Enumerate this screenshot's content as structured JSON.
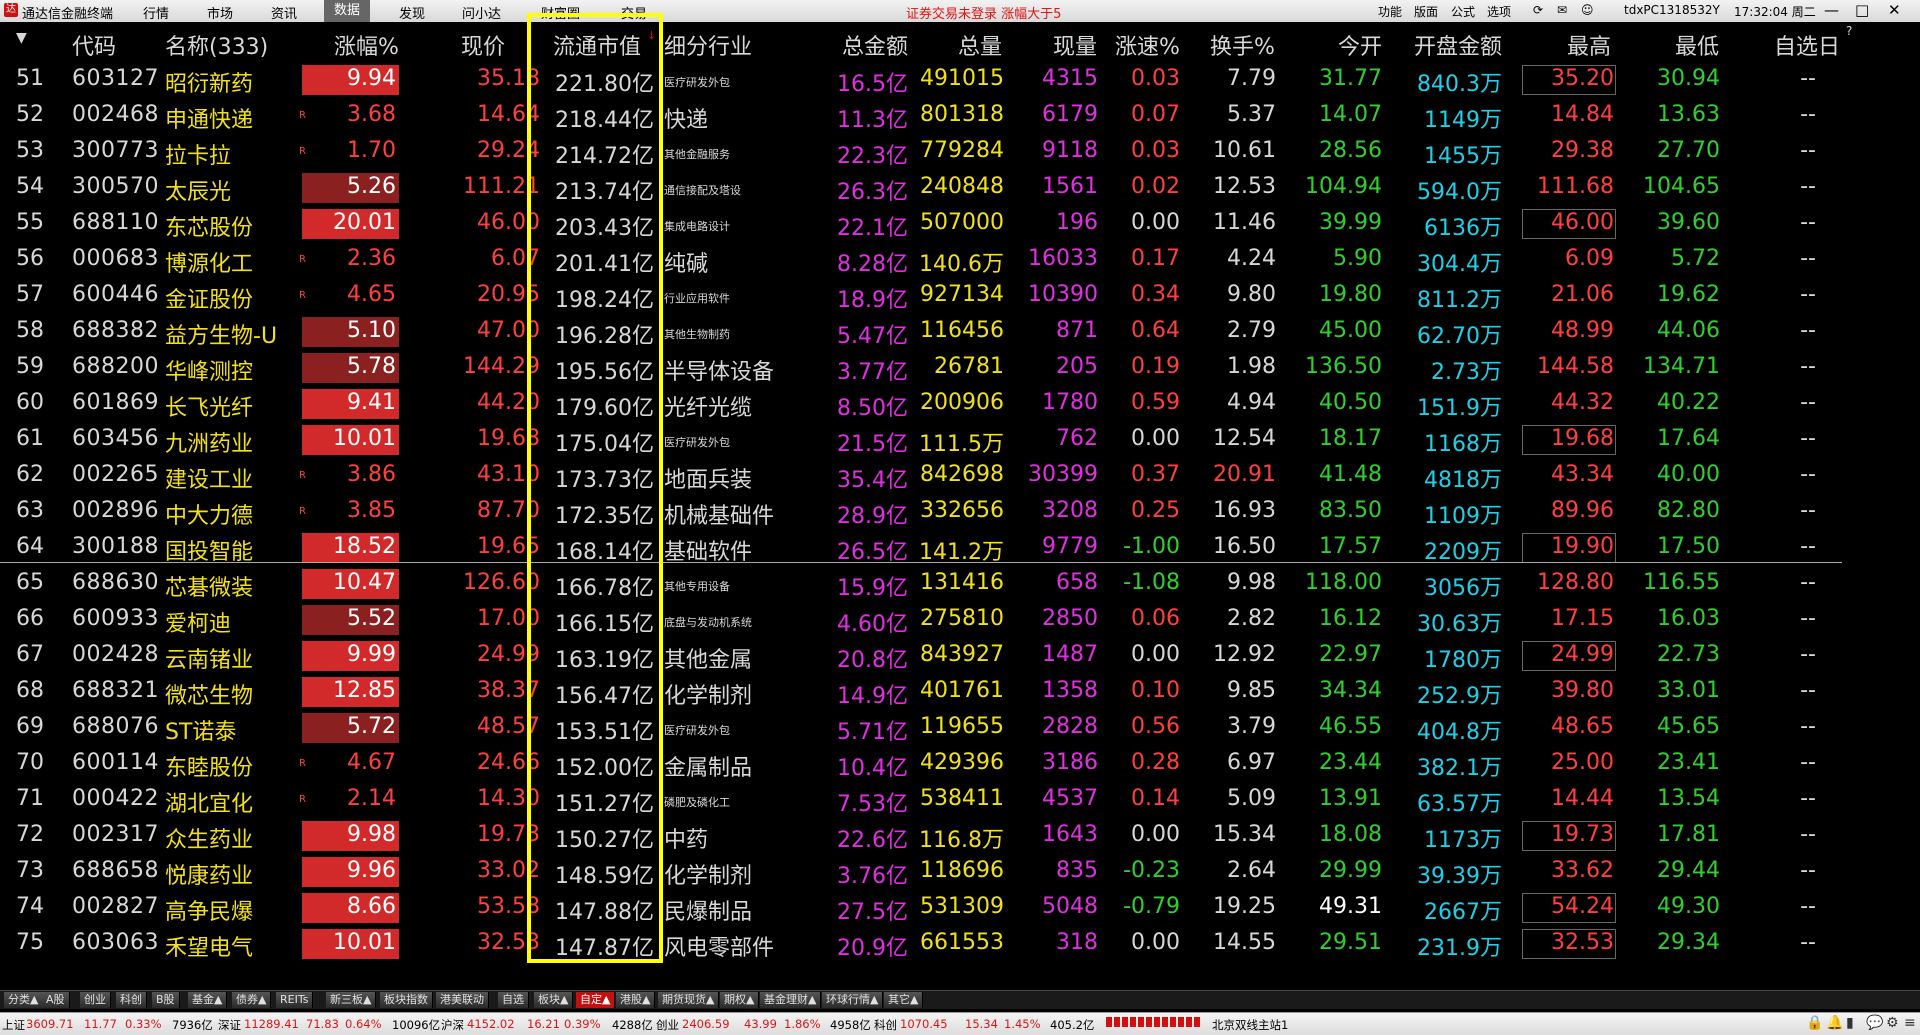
{
  "topbar": {
    "app_title": "通达信金融终端",
    "menus": [
      "行情",
      "市场",
      "资讯",
      "数据",
      "发现",
      "问小达",
      "财富圈",
      "交易"
    ],
    "active_menu": "数据",
    "notice": "证券交易未登录  涨幅大于5",
    "right_items": [
      "功能",
      "版面",
      "公式",
      "选项"
    ],
    "account": "tdxPC1318532Y",
    "time": "17:32:04 周二",
    "win_buttons": [
      "—",
      "□",
      "✕"
    ]
  },
  "header": {
    "code": "代码",
    "name": "名称(333)",
    "change_pct": "涨幅%",
    "price": "现价",
    "mkt_cap": "流通市值",
    "industry": "细分行业",
    "amount": "总金额",
    "volume": "总量",
    "cur_vol": "现量",
    "speed": "涨速%",
    "turnover": "换手%",
    "open": "今开",
    "open_amount": "开盘金额",
    "high": "最高",
    "low": "最低",
    "favorite": "自选日",
    "sort_mark": "↓",
    "help_mark": "?"
  },
  "rows": [
    {
      "idx": "51",
      "code": "603127",
      "name": "昭衍新药",
      "r": "",
      "chg": "9.94",
      "chg_bg": "#d22a2a",
      "price": "35.18",
      "mcap": "221.80亿",
      "ind": "医疗研发外包",
      "ind_small": true,
      "amt": "16.5亿",
      "vol": "491015",
      "cur": "4315",
      "spd": "0.03",
      "spd_t": "p",
      "turn": "7.79",
      "turn_r": false,
      "open": "31.77",
      "open_w": false,
      "oamt": "840.3万",
      "high": "35.20",
      "high_box": true,
      "low": "30.94",
      "fav": "--"
    },
    {
      "idx": "52",
      "code": "002468",
      "name": "申通快递",
      "r": "R",
      "chg": "3.68",
      "chg_bg": "",
      "price": "14.64",
      "mcap": "218.44亿",
      "ind": "快递",
      "ind_small": false,
      "amt": "11.3亿",
      "vol": "801318",
      "cur": "6179",
      "spd": "0.07",
      "spd_t": "p",
      "turn": "5.37",
      "turn_r": false,
      "open": "14.07",
      "open_w": false,
      "oamt": "1149万",
      "high": "14.84",
      "high_box": false,
      "low": "13.63",
      "fav": "--"
    },
    {
      "idx": "53",
      "code": "300773",
      "name": "拉卡拉",
      "r": "R",
      "chg": "1.70",
      "chg_bg": "",
      "price": "29.24",
      "mcap": "214.72亿",
      "ind": "其他金融服务",
      "ind_small": true,
      "amt": "22.3亿",
      "vol": "779284",
      "cur": "9118",
      "spd": "0.03",
      "spd_t": "p",
      "turn": "10.61",
      "turn_r": false,
      "open": "28.56",
      "open_w": false,
      "oamt": "1455万",
      "high": "29.38",
      "high_box": false,
      "low": "27.70",
      "fav": "--"
    },
    {
      "idx": "54",
      "code": "300570",
      "name": "太辰光",
      "r": "",
      "chg": "5.26",
      "chg_bg": "#8a2020",
      "price": "111.21",
      "mcap": "213.74亿",
      "ind": "通信接配及塔设",
      "ind_small": true,
      "amt": "26.3亿",
      "vol": "240848",
      "cur": "1561",
      "spd": "0.02",
      "spd_t": "p",
      "turn": "12.53",
      "turn_r": false,
      "open": "104.94",
      "open_w": false,
      "oamt": "594.0万",
      "high": "111.68",
      "high_box": false,
      "low": "104.65",
      "fav": "--"
    },
    {
      "idx": "55",
      "code": "688110",
      "name": "东芯股份",
      "r": "",
      "chg": "20.01",
      "chg_bg": "#d22a2a",
      "price": "46.00",
      "mcap": "203.43亿",
      "ind": "集成电路设计",
      "ind_small": true,
      "amt": "22.1亿",
      "vol": "507000",
      "cur": "196",
      "spd": "0.00",
      "spd_t": "z",
      "turn": "11.46",
      "turn_r": false,
      "open": "39.99",
      "open_w": false,
      "oamt": "6136万",
      "high": "46.00",
      "high_box": true,
      "low": "39.60",
      "fav": "--"
    },
    {
      "idx": "56",
      "code": "000683",
      "name": "博源化工",
      "r": "R",
      "chg": "2.36",
      "chg_bg": "",
      "price": "6.07",
      "mcap": "201.41亿",
      "ind": "纯碱",
      "ind_small": false,
      "amt": "8.28亿",
      "vol": "140.6万",
      "cur": "16033",
      "spd": "0.17",
      "spd_t": "p",
      "turn": "4.24",
      "turn_r": false,
      "open": "5.90",
      "open_w": false,
      "oamt": "304.4万",
      "high": "6.09",
      "high_box": false,
      "low": "5.72",
      "fav": "--"
    },
    {
      "idx": "57",
      "code": "600446",
      "name": "金证股份",
      "r": "R",
      "chg": "4.65",
      "chg_bg": "",
      "price": "20.95",
      "mcap": "198.24亿",
      "ind": "行业应用软件",
      "ind_small": true,
      "amt": "18.9亿",
      "vol": "927134",
      "cur": "10390",
      "spd": "0.34",
      "spd_t": "p",
      "turn": "9.80",
      "turn_r": false,
      "open": "19.80",
      "open_w": false,
      "oamt": "811.2万",
      "high": "21.06",
      "high_box": false,
      "low": "19.62",
      "fav": "--"
    },
    {
      "idx": "58",
      "code": "688382",
      "name": "益方生物-U",
      "r": "",
      "chg": "5.10",
      "chg_bg": "#8a2020",
      "price": "47.00",
      "mcap": "196.28亿",
      "ind": "其他生物制药",
      "ind_small": true,
      "amt": "5.47亿",
      "vol": "116456",
      "cur": "871",
      "spd": "0.64",
      "spd_t": "p",
      "turn": "2.79",
      "turn_r": false,
      "open": "45.00",
      "open_w": false,
      "oamt": "62.70万",
      "high": "48.99",
      "high_box": false,
      "low": "44.06",
      "fav": "--"
    },
    {
      "idx": "59",
      "code": "688200",
      "name": "华峰测控",
      "r": "",
      "chg": "5.78",
      "chg_bg": "#8a2020",
      "price": "144.29",
      "mcap": "195.56亿",
      "ind": "半导体设备",
      "ind_small": false,
      "amt": "3.77亿",
      "vol": "26781",
      "cur": "205",
      "spd": "0.19",
      "spd_t": "p",
      "turn": "1.98",
      "turn_r": false,
      "open": "136.50",
      "open_w": false,
      "oamt": "2.73万",
      "high": "144.58",
      "high_box": false,
      "low": "134.71",
      "fav": "--"
    },
    {
      "idx": "60",
      "code": "601869",
      "name": "长飞光纤",
      "r": "",
      "chg": "9.41",
      "chg_bg": "#d22a2a",
      "price": "44.20",
      "mcap": "179.60亿",
      "ind": "光纤光缆",
      "ind_small": false,
      "amt": "8.50亿",
      "vol": "200906",
      "cur": "1780",
      "spd": "0.59",
      "spd_t": "p",
      "turn": "4.94",
      "turn_r": false,
      "open": "40.50",
      "open_w": false,
      "oamt": "151.9万",
      "high": "44.32",
      "high_box": false,
      "low": "40.22",
      "fav": "--"
    },
    {
      "idx": "61",
      "code": "603456",
      "name": "九洲药业",
      "r": "",
      "chg": "10.01",
      "chg_bg": "#d22a2a",
      "price": "19.68",
      "mcap": "175.04亿",
      "ind": "医疗研发外包",
      "ind_small": true,
      "amt": "21.5亿",
      "vol": "111.5万",
      "cur": "762",
      "spd": "0.00",
      "spd_t": "z",
      "turn": "12.54",
      "turn_r": false,
      "open": "18.17",
      "open_w": false,
      "oamt": "1168万",
      "high": "19.68",
      "high_box": true,
      "low": "17.64",
      "fav": "--"
    },
    {
      "idx": "62",
      "code": "002265",
      "name": "建设工业",
      "r": "R",
      "chg": "3.86",
      "chg_bg": "",
      "price": "43.10",
      "mcap": "173.73亿",
      "ind": "地面兵装",
      "ind_small": false,
      "amt": "35.4亿",
      "vol": "842698",
      "cur": "30399",
      "spd": "0.37",
      "spd_t": "p",
      "turn": "20.91",
      "turn_r": true,
      "open": "41.48",
      "open_w": false,
      "oamt": "4818万",
      "high": "43.34",
      "high_box": false,
      "low": "40.00",
      "fav": "--"
    },
    {
      "idx": "63",
      "code": "002896",
      "name": "中大力德",
      "r": "R",
      "chg": "3.85",
      "chg_bg": "",
      "price": "87.70",
      "mcap": "172.35亿",
      "ind": "机械基础件",
      "ind_small": false,
      "amt": "28.9亿",
      "vol": "332656",
      "cur": "3208",
      "spd": "0.25",
      "spd_t": "p",
      "turn": "16.93",
      "turn_r": false,
      "open": "83.50",
      "open_w": false,
      "oamt": "1109万",
      "high": "89.96",
      "high_box": false,
      "low": "82.80",
      "fav": "--"
    },
    {
      "idx": "64",
      "code": "300188",
      "name": "国投智能",
      "r": "",
      "chg": "18.52",
      "chg_bg": "#d22a2a",
      "price": "19.65",
      "mcap": "168.14亿",
      "ind": "基础软件",
      "ind_small": false,
      "amt": "26.5亿",
      "vol": "141.2万",
      "cur": "9779",
      "spd": "-1.00",
      "spd_t": "n",
      "turn": "16.50",
      "turn_r": false,
      "open": "17.57",
      "open_w": false,
      "oamt": "2209万",
      "high": "19.90",
      "high_box": true,
      "low": "17.50",
      "fav": "--"
    },
    {
      "idx": "65",
      "code": "688630",
      "name": "芯碁微装",
      "r": "",
      "chg": "10.47",
      "chg_bg": "#d22a2a",
      "price": "126.60",
      "mcap": "166.78亿",
      "ind": "其他专用设备",
      "ind_small": true,
      "amt": "15.9亿",
      "vol": "131416",
      "cur": "658",
      "spd": "-1.08",
      "spd_t": "n",
      "turn": "9.98",
      "turn_r": false,
      "open": "118.00",
      "open_w": false,
      "oamt": "3056万",
      "high": "128.80",
      "high_box": false,
      "low": "116.55",
      "fav": "--"
    },
    {
      "idx": "66",
      "code": "600933",
      "name": "爱柯迪",
      "r": "",
      "chg": "5.52",
      "chg_bg": "#8a2020",
      "price": "17.00",
      "mcap": "166.15亿",
      "ind": "底盘与发动机系统",
      "ind_small": true,
      "amt": "4.60亿",
      "vol": "275810",
      "cur": "2850",
      "spd": "0.06",
      "spd_t": "p",
      "turn": "2.82",
      "turn_r": false,
      "open": "16.12",
      "open_w": false,
      "oamt": "30.63万",
      "high": "17.15",
      "high_box": false,
      "low": "16.03",
      "fav": "--"
    },
    {
      "idx": "67",
      "code": "002428",
      "name": "云南锗业",
      "r": "",
      "chg": "9.99",
      "chg_bg": "#d22a2a",
      "price": "24.99",
      "mcap": "163.19亿",
      "ind": "其他金属",
      "ind_small": false,
      "amt": "20.8亿",
      "vol": "843927",
      "cur": "1487",
      "spd": "0.00",
      "spd_t": "z",
      "turn": "12.92",
      "turn_r": false,
      "open": "22.97",
      "open_w": false,
      "oamt": "1780万",
      "high": "24.99",
      "high_box": true,
      "low": "22.73",
      "fav": "--"
    },
    {
      "idx": "68",
      "code": "688321",
      "name": "微芯生物",
      "r": "",
      "chg": "12.85",
      "chg_bg": "#d22a2a",
      "price": "38.37",
      "mcap": "156.47亿",
      "ind": "化学制剂",
      "ind_small": false,
      "amt": "14.9亿",
      "vol": "401761",
      "cur": "1358",
      "spd": "0.10",
      "spd_t": "p",
      "turn": "9.85",
      "turn_r": false,
      "open": "34.34",
      "open_w": false,
      "oamt": "252.9万",
      "high": "39.80",
      "high_box": false,
      "low": "33.01",
      "fav": "--"
    },
    {
      "idx": "69",
      "code": "688076",
      "name": "ST诺泰",
      "r": "",
      "chg": "5.72",
      "chg_bg": "#8a2020",
      "price": "48.57",
      "mcap": "153.51亿",
      "ind": "医疗研发外包",
      "ind_small": true,
      "amt": "5.71亿",
      "vol": "119655",
      "cur": "2828",
      "spd": "0.56",
      "spd_t": "p",
      "turn": "3.79",
      "turn_r": false,
      "open": "46.55",
      "open_w": false,
      "oamt": "404.8万",
      "high": "48.65",
      "high_box": false,
      "low": "45.65",
      "fav": "--"
    },
    {
      "idx": "70",
      "code": "600114",
      "name": "东睦股份",
      "r": "R",
      "chg": "4.67",
      "chg_bg": "",
      "price": "24.66",
      "mcap": "152.00亿",
      "ind": "金属制品",
      "ind_small": false,
      "amt": "10.4亿",
      "vol": "429396",
      "cur": "3186",
      "spd": "0.28",
      "spd_t": "p",
      "turn": "6.97",
      "turn_r": false,
      "open": "23.44",
      "open_w": false,
      "oamt": "382.1万",
      "high": "25.00",
      "high_box": false,
      "low": "23.41",
      "fav": "--"
    },
    {
      "idx": "71",
      "code": "000422",
      "name": "湖北宜化",
      "r": "R",
      "chg": "2.14",
      "chg_bg": "",
      "price": "14.30",
      "mcap": "151.27亿",
      "ind": "磷肥及磷化工",
      "ind_small": true,
      "amt": "7.53亿",
      "vol": "538411",
      "cur": "4537",
      "spd": "0.14",
      "spd_t": "p",
      "turn": "5.09",
      "turn_r": false,
      "open": "13.91",
      "open_w": false,
      "oamt": "63.57万",
      "high": "14.44",
      "high_box": false,
      "low": "13.54",
      "fav": "--"
    },
    {
      "idx": "72",
      "code": "002317",
      "name": "众生药业",
      "r": "",
      "chg": "9.98",
      "chg_bg": "#d22a2a",
      "price": "19.73",
      "mcap": "150.27亿",
      "ind": "中药",
      "ind_small": false,
      "amt": "22.6亿",
      "vol": "116.8万",
      "cur": "1643",
      "spd": "0.00",
      "spd_t": "z",
      "turn": "15.34",
      "turn_r": false,
      "open": "18.08",
      "open_w": false,
      "oamt": "1173万",
      "high": "19.73",
      "high_box": true,
      "low": "17.81",
      "fav": "--"
    },
    {
      "idx": "73",
      "code": "688658",
      "name": "悦康药业",
      "r": "",
      "chg": "9.96",
      "chg_bg": "#d22a2a",
      "price": "33.02",
      "mcap": "148.59亿",
      "ind": "化学制剂",
      "ind_small": false,
      "amt": "3.76亿",
      "vol": "118696",
      "cur": "835",
      "spd": "-0.23",
      "spd_t": "n",
      "turn": "2.64",
      "turn_r": false,
      "open": "29.99",
      "open_w": false,
      "oamt": "39.39万",
      "high": "33.62",
      "high_box": false,
      "low": "29.44",
      "fav": "--"
    },
    {
      "idx": "74",
      "code": "002827",
      "name": "高争民爆",
      "r": "",
      "chg": "8.66",
      "chg_bg": "#d22a2a",
      "price": "53.58",
      "mcap": "147.88亿",
      "ind": "民爆制品",
      "ind_small": false,
      "amt": "27.5亿",
      "vol": "531309",
      "cur": "5048",
      "spd": "-0.79",
      "spd_t": "n",
      "turn": "19.25",
      "turn_r": false,
      "open": "49.31",
      "open_w": true,
      "oamt": "2667万",
      "high": "54.24",
      "high_box": true,
      "low": "49.30",
      "fav": "--"
    },
    {
      "idx": "75",
      "code": "603063",
      "name": "禾望电气",
      "r": "",
      "chg": "10.01",
      "chg_bg": "#d22a2a",
      "price": "32.53",
      "mcap": "147.87亿",
      "ind": "风电零部件",
      "ind_small": false,
      "amt": "20.9亿",
      "vol": "661553",
      "cur": "318",
      "spd": "0.00",
      "spd_t": "z",
      "turn": "14.55",
      "turn_r": false,
      "open": "29.51",
      "open_w": false,
      "oamt": "231.9万",
      "high": "32.53",
      "high_box": true,
      "low": "29.34",
      "fav": "--"
    }
  ],
  "tabs": [
    "分类▲",
    "A股",
    "创业",
    "科创",
    "B股",
    "基金▲",
    "债券▲",
    "REITs",
    "新三板▲",
    "板块指数",
    "港美联动",
    "自选",
    "板块▲",
    "自定▲",
    "港股▲",
    "期货现货▲",
    "期权▲",
    "基金理财▲",
    "环球行情▲",
    "其它▲"
  ],
  "active_tab": "自定▲",
  "status": {
    "sh_label": "上证",
    "sh_val": "3609.71",
    "sh_chg": "11.77",
    "sh_pct": "0.33%",
    "sh_amt": "7936亿",
    "sz_label": "深证",
    "sz_val": "11289.41",
    "sz_chg": "71.83",
    "sz_pct": "0.64%",
    "sz_amt": "10096亿",
    "hs_label": "沪深",
    "hs_val": "4152.02",
    "hs_chg": "16.21",
    "hs_pct": "0.39%",
    "hs_amt": "4288亿",
    "cy_label": "创业",
    "cy_val": "2406.59",
    "cy_chg": "43.99",
    "cy_pct": "1.86%",
    "cy_amt": "4958亿",
    "kc_label": "科创",
    "kc_val": "1070.45",
    "kc_chg": "15.34",
    "kc_pct": "1.45%",
    "kc_amt": "405.2亿",
    "server": "北京双线主站1"
  }
}
